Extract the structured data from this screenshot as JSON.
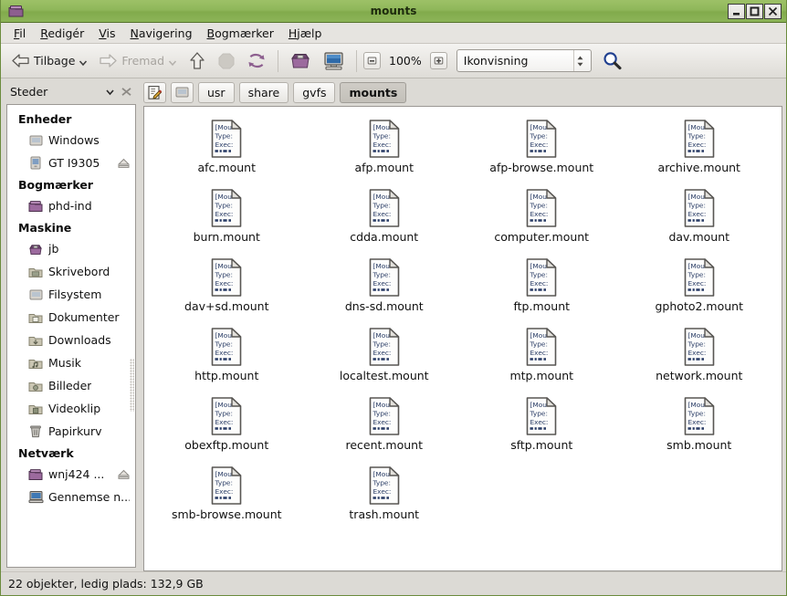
{
  "window": {
    "title": "mounts",
    "titlebar_icon": "folder-icon",
    "buttons": [
      {
        "name": "minimize-button",
        "glyph": "_"
      },
      {
        "name": "maximize-button",
        "glyph": "□"
      },
      {
        "name": "close-button",
        "glyph": "✕"
      }
    ]
  },
  "menubar": {
    "items": [
      {
        "label": "Fil",
        "accel": "F"
      },
      {
        "label": "Redigér",
        "accel": "R"
      },
      {
        "label": "Vis",
        "accel": "V"
      },
      {
        "label": "Navigering",
        "accel": "N"
      },
      {
        "label": "Bogmærker",
        "accel": "B"
      },
      {
        "label": "Hjælp",
        "accel": "H"
      }
    ]
  },
  "toolbar": {
    "back_label": "Tilbage",
    "forward_label": "Fremad",
    "up_icon": "up-arrow-icon",
    "stop_icon": "stop-icon",
    "reload_icon": "reload-icon",
    "home_icon": "home-icon",
    "computer_icon": "computer-icon",
    "zoom_out_icon": "zoom-out-icon",
    "zoom_level": "100%",
    "zoom_in_icon": "zoom-in-icon",
    "view_mode": "Ikonvisning",
    "search_icon": "search-icon"
  },
  "sidebar": {
    "title": "Steder",
    "collapse_icon": "chevron-down-icon",
    "close_icon": "close-icon",
    "groups": [
      {
        "heading": "Enheder",
        "items": [
          {
            "label": "Windows",
            "icon": "drive-icon",
            "eject": false
          },
          {
            "label": "GT I9305",
            "icon": "phone-icon",
            "eject": true
          }
        ]
      },
      {
        "heading": "Bogmærker",
        "items": [
          {
            "label": "phd-ind",
            "icon": "folder-icon",
            "eject": false
          }
        ]
      },
      {
        "heading": "Maskine",
        "items": [
          {
            "label": "jb",
            "icon": "home-folder-icon",
            "eject": false
          },
          {
            "label": "Skrivebord",
            "icon": "desktop-folder-icon",
            "eject": false
          },
          {
            "label": "Filsystem",
            "icon": "drive-icon",
            "eject": false
          },
          {
            "label": "Dokumenter",
            "icon": "documents-folder-icon",
            "eject": false
          },
          {
            "label": "Downloads",
            "icon": "downloads-folder-icon",
            "eject": false
          },
          {
            "label": "Musik",
            "icon": "music-folder-icon",
            "eject": false
          },
          {
            "label": "Billeder",
            "icon": "pictures-folder-icon",
            "eject": false
          },
          {
            "label": "Videoklip",
            "icon": "videos-folder-icon",
            "eject": false
          },
          {
            "label": "Papirkurv",
            "icon": "trash-icon",
            "eject": false
          }
        ]
      },
      {
        "heading": "Netværk",
        "items": [
          {
            "label": "wnj424 ...",
            "icon": "network-folder-icon",
            "eject": true
          },
          {
            "label": "Gennemse n...",
            "icon": "network-browse-icon",
            "eject": false
          }
        ]
      }
    ]
  },
  "pathbar": {
    "edit_icon": "edit-location-icon",
    "root_icon": "filesystem-icon",
    "crumbs": [
      {
        "label": "usr",
        "current": false
      },
      {
        "label": "share",
        "current": false
      },
      {
        "label": "gvfs",
        "current": false
      },
      {
        "label": "mounts",
        "current": true
      }
    ]
  },
  "iconview": {
    "file_icon": "text-document-icon",
    "file_icon_preview": [
      "[Mou",
      "Type:",
      "Exec:"
    ],
    "files": [
      "afc.mount",
      "afp.mount",
      "afp-browse.mount",
      "archive.mount",
      "burn.mount",
      "cdda.mount",
      "computer.mount",
      "dav.mount",
      "dav+sd.mount",
      "dns-sd.mount",
      "ftp.mount",
      "gphoto2.mount",
      "http.mount",
      "localtest.mount",
      "mtp.mount",
      "network.mount",
      "obexftp.mount",
      "recent.mount",
      "sftp.mount",
      "smb.mount",
      "smb-browse.mount",
      "trash.mount"
    ]
  },
  "statusbar": {
    "text": "22 objekter, ledig plads: 132,9 GB"
  },
  "colors": {
    "titlebar_green": "#8fb75a",
    "accent_purple": "#8d5f8f",
    "window_bg": "#dcdad5",
    "pane_bg": "#ffffff"
  }
}
